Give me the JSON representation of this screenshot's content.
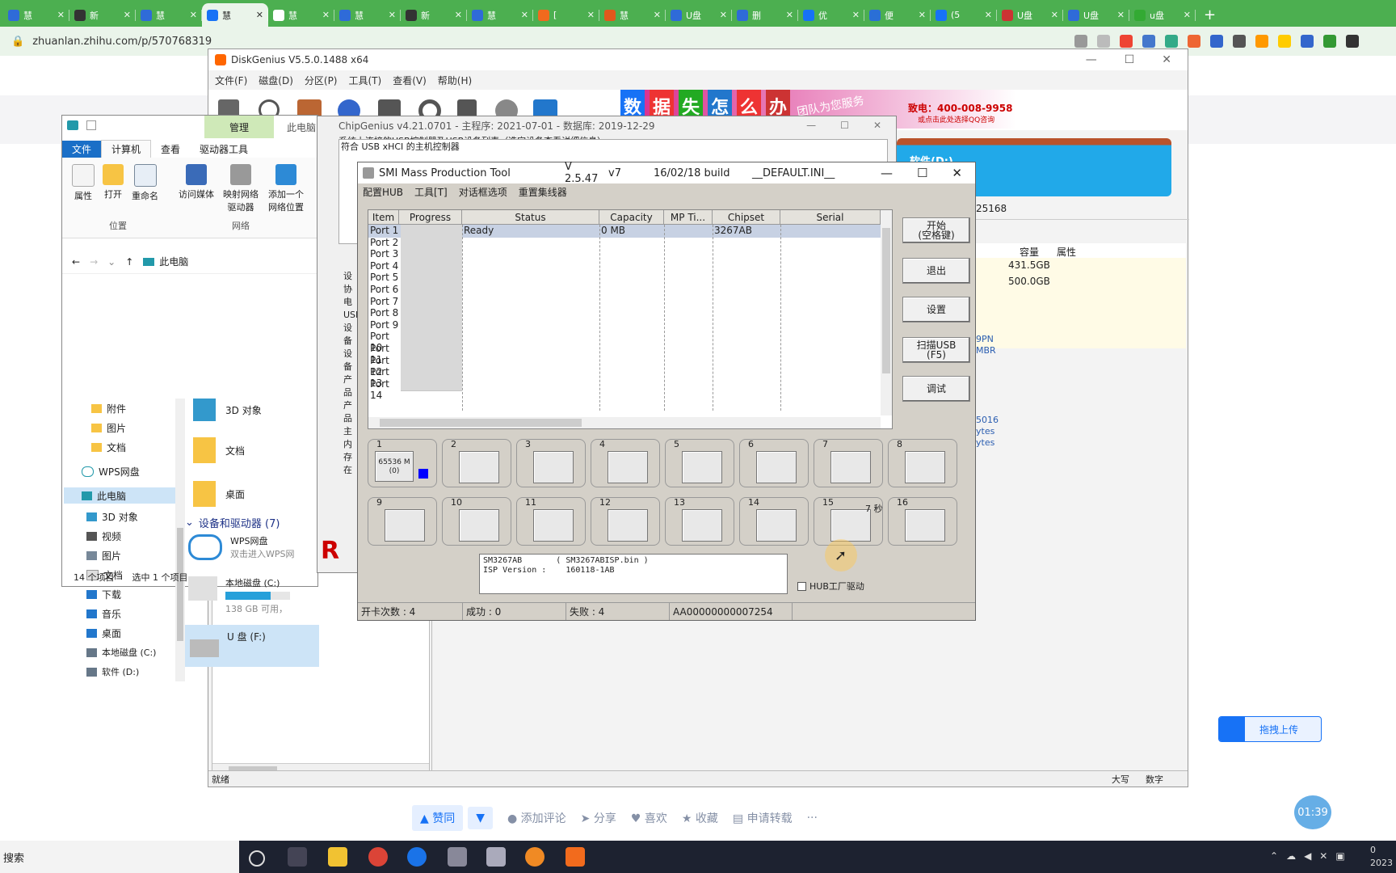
{
  "browser": {
    "tabs": [
      {
        "label": "慧",
        "icon": "baidu"
      },
      {
        "label": "新",
        "icon": "infinity"
      },
      {
        "label": "慧",
        "icon": "baidu"
      },
      {
        "label": "慧",
        "icon": "zhihu",
        "active": true
      },
      {
        "label": "慧",
        "icon": "doc"
      },
      {
        "label": "慧",
        "icon": "baidu"
      },
      {
        "label": "新",
        "icon": "infinity"
      },
      {
        "label": "慧",
        "icon": "baidu"
      },
      {
        "label": "[",
        "icon": "c-orange"
      },
      {
        "label": "慧",
        "icon": "pen"
      },
      {
        "label": "U盘",
        "icon": "baidu"
      },
      {
        "label": "删",
        "icon": "baidu"
      },
      {
        "label": "优",
        "icon": "zhihu"
      },
      {
        "label": "便",
        "icon": "ps"
      },
      {
        "label": "(5",
        "icon": "zhihu"
      },
      {
        "label": "U盘",
        "icon": "z"
      },
      {
        "label": "U盘",
        "icon": "baidu"
      },
      {
        "label": "u盘",
        "icon": "chrome"
      }
    ],
    "url": "zhuanlan.zhihu.com/p/570768319"
  },
  "diskgenius": {
    "title": "DiskGenius V5.5.0.1488 x64",
    "menu": [
      "文件(F)",
      "磁盘(D)",
      "分区(P)",
      "工具(T)",
      "查看(V)",
      "帮助(H)"
    ],
    "ad_text": "团队为您服务",
    "ad_phone": "致电：400-008-9958",
    "ad_qq": "或点击此处选择QQ咨询",
    "ad_chars": [
      "数",
      "据",
      "失",
      "怎",
      "么",
      "办"
    ],
    "partial_label": "软件(D:)",
    "serial_fragment": "25168",
    "table_headers": [
      "容量",
      "属性"
    ],
    "table_rows": [
      {
        "capacity": "431.5GB"
      },
      {
        "capacity": "500.0GB"
      }
    ],
    "side_text": [
      "9PN",
      "MBR",
      "5016",
      "ytes",
      "ytes"
    ],
    "status_left": "就绪",
    "status_right": [
      "大写",
      "数字"
    ]
  },
  "explorer": {
    "ribbon_top_tab": "管理",
    "ribbon_top_label": "此电脑",
    "ribbon_tabs": [
      "文件",
      "计算机",
      "查看",
      "驱动器工具"
    ],
    "ribbon_buttons": [
      "属性",
      "打开",
      "重命名",
      "访问媒体",
      "映射网络驱动器",
      "添加一个网络位置"
    ],
    "group_labels": [
      "位置",
      "网络"
    ],
    "breadcrumb": "此电脑",
    "tree": [
      "附件",
      "图片",
      "文档",
      "WPS网盘",
      "此电脑",
      "3D 对象",
      "视频",
      "图片",
      "文档",
      "下载",
      "音乐",
      "桌面",
      "本地磁盘 (C:)",
      "软件 (D:)"
    ],
    "content": {
      "item_3d": "3D 对象",
      "item_docs": "文档",
      "item_desktop": "桌面",
      "section": "设备和驱动器 (7)",
      "wps_name": "WPS网盘",
      "wps_sub": "双击进入WPS网",
      "c_name": "本地磁盘 (C:)",
      "c_free": "138 GB 可用，",
      "f_name": "U 盘 (F:)"
    },
    "status_items": "14 个项目",
    "status_selected": "选中 1 个项目",
    "c_usage_fraction": 0.7
  },
  "chipgenius": {
    "title": "ChipGenius v4.21.0701 - 主程序: 2021-07-01 - 数据库: 2019-12-29",
    "list_header": "系统上连接的USB控制器及USB设备列表（选定设备查看详细信息）:",
    "list_line1": "符合 USB xHCI 的主机控制器",
    "left_labels": [
      "设",
      "协",
      "电",
      "USB",
      "设备",
      "设备",
      "产品",
      "产品",
      "主",
      "内存",
      "在"
    ]
  },
  "smi": {
    "title": "SMI Mass Production Tool",
    "version": "V 2.5.47",
    "version_tag": "v7",
    "build": "16/02/18 build",
    "ini": "__DEFAULT.INI__",
    "menu": [
      "配置HUB",
      "工具[T]",
      "对话框选项",
      "重置集线器"
    ],
    "columns": [
      "Item",
      "Progress",
      "Status",
      "Capacity",
      "MP Ti...",
      "Chipset",
      "Serial"
    ],
    "ports": [
      {
        "item": "Port 1",
        "status": "Ready",
        "capacity": "0 MB",
        "chipset": "3267AB",
        "selected": true
      },
      {
        "item": "Port 2"
      },
      {
        "item": "Port 3"
      },
      {
        "item": "Port 4"
      },
      {
        "item": "Port 5"
      },
      {
        "item": "Port 6"
      },
      {
        "item": "Port 7"
      },
      {
        "item": "Port 8"
      },
      {
        "item": "Port 9"
      },
      {
        "item": "Port 10"
      },
      {
        "item": "Port 11"
      },
      {
        "item": "Port 12"
      },
      {
        "item": "Port 13"
      },
      {
        "item": "Port 14"
      }
    ],
    "buttons": [
      {
        "label": "开始\n(空格键)",
        "name": "start"
      },
      {
        "label": "退出",
        "name": "exit"
      },
      {
        "label": "设置",
        "name": "settings"
      },
      {
        "label": "扫描USB\n(F5)",
        "name": "scan-usb"
      },
      {
        "label": "调试",
        "name": "debug"
      }
    ],
    "slots": [
      "1",
      "2",
      "3",
      "4",
      "5",
      "6",
      "7",
      "8",
      "9",
      "10",
      "11",
      "12",
      "13",
      "14",
      "15",
      "16"
    ],
    "slot1_text": "65536 M\n(0)",
    "timer": "7 秒",
    "info_line1": "SM3267AB       ( SM3267ABISP.bin )",
    "info_line2": "ISP Version :    160118-1AB",
    "hub_checkbox": "HUB工厂驱动",
    "status_bar": [
      "开卡次数 : 4",
      "成功 : 0",
      "失败 : 4",
      "AA00000000007254"
    ]
  },
  "article_bar": {
    "like": "赞同",
    "comment": "添加评论",
    "share": "分享",
    "favorite": "喜欢",
    "collect": "收藏",
    "reprint": "申请转载",
    "more": "···"
  },
  "upload_button": "拖拽上传",
  "video_timer": "01:39",
  "taskbar": {
    "search": "搜索",
    "clock": "0\n2023"
  },
  "colors": {
    "chrome_green": "#4caf50",
    "zhihu_blue": "#1772f6",
    "taskbar": "#1d2230"
  }
}
